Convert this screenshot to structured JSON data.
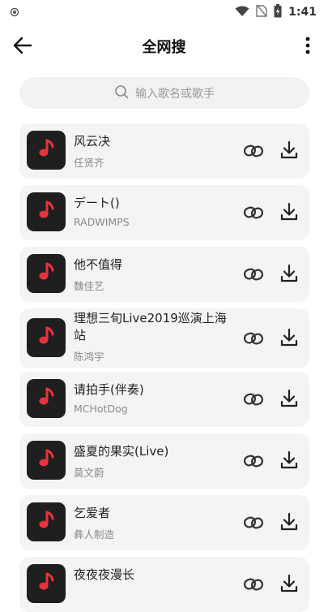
{
  "status_bar": {
    "time": "1:41"
  },
  "header": {
    "title": "全网搜"
  },
  "search": {
    "placeholder": "输入歌名或歌手"
  },
  "songs": [
    {
      "title": "风云决",
      "artist": "任贤齐"
    },
    {
      "title": "デート()",
      "artist": "RADWIMPS"
    },
    {
      "title": "他不值得",
      "artist": "魏佳艺"
    },
    {
      "title": "理想三旬Live2019巡演上海站",
      "artist": "陈鸿宇"
    },
    {
      "title": "请拍手(伴奏)",
      "artist": "MCHotDog"
    },
    {
      "title": "盛夏的果实(Live)",
      "artist": "莫文蔚"
    },
    {
      "title": "乞爱者",
      "artist": "彝人制造"
    },
    {
      "title": "夜夜夜漫长",
      "artist": ""
    }
  ],
  "colors": {
    "cover_bg": "#1f1f1f",
    "note_red": "#e8323c",
    "item_bg": "#f4f4f4"
  }
}
